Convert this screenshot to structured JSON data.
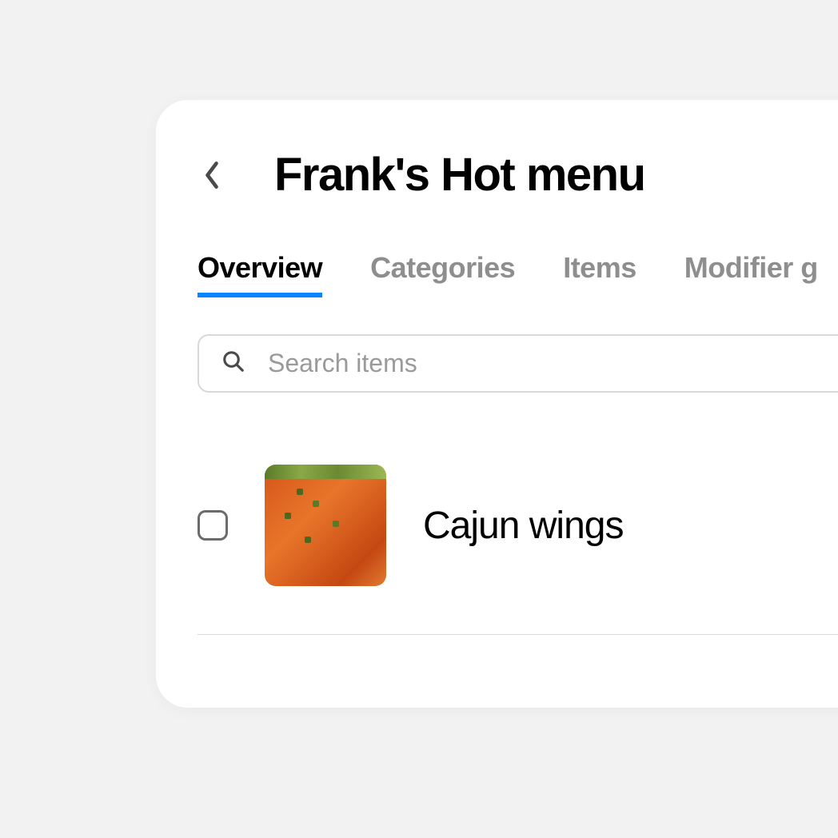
{
  "header": {
    "title": "Frank's Hot menu"
  },
  "tabs": [
    {
      "label": "Overview",
      "active": true
    },
    {
      "label": "Categories",
      "active": false
    },
    {
      "label": "Items",
      "active": false
    },
    {
      "label": "Modifier g",
      "active": false
    }
  ],
  "search": {
    "placeholder": "Search items"
  },
  "items": [
    {
      "name": "Cajun wings",
      "checked": false
    }
  ]
}
